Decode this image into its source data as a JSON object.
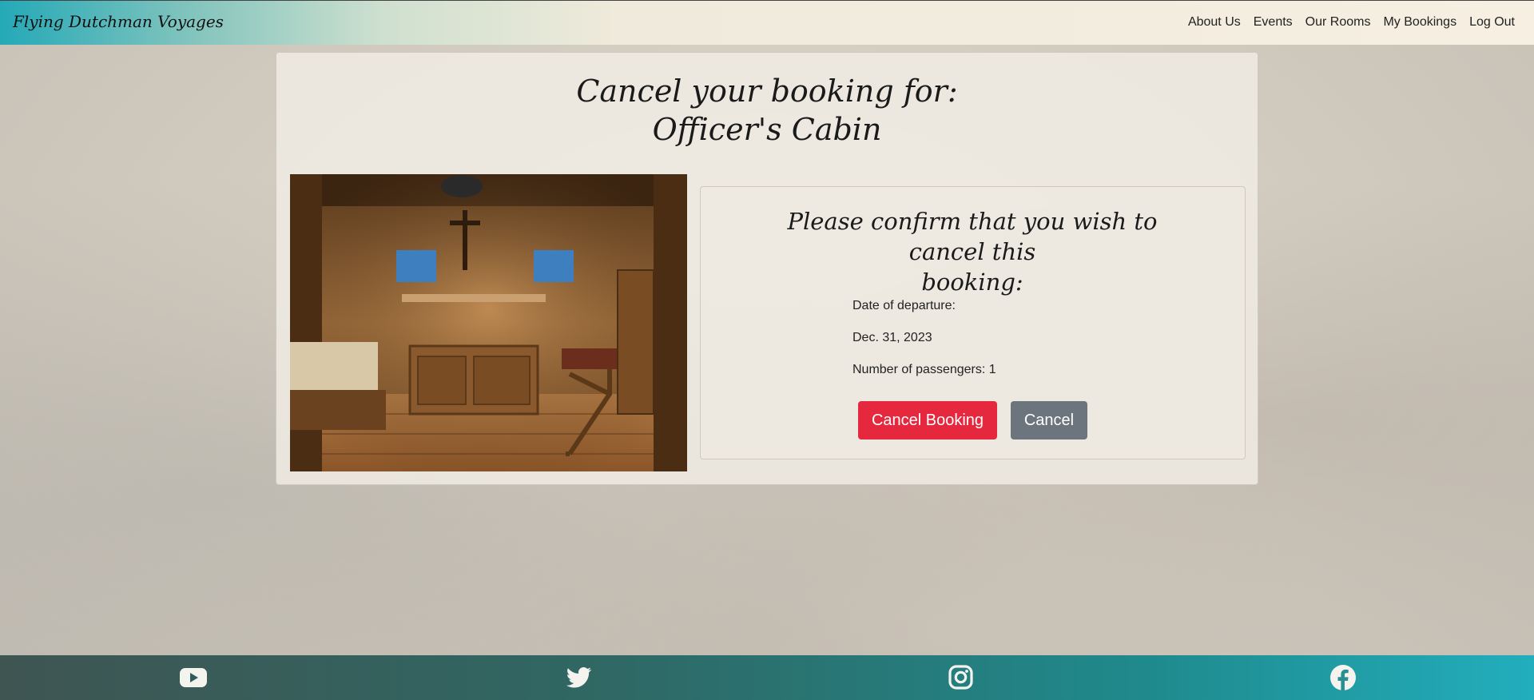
{
  "navbar": {
    "brand": "Flying Dutchman Voyages",
    "links": [
      {
        "label": "About Us"
      },
      {
        "label": "Events"
      },
      {
        "label": "Our Rooms"
      },
      {
        "label": "My Bookings"
      },
      {
        "label": "Log Out"
      }
    ]
  },
  "page": {
    "title_line1": "Cancel your booking for:",
    "title_line2": "Officer's Cabin"
  },
  "confirm": {
    "heading_line1": "Please confirm that you wish to cancel this",
    "heading_line2": "booking:",
    "departure_label": "Date of departure:",
    "departure_date": "Dec. 31, 2023",
    "passengers_text": "Number of passengers: 1",
    "cancel_booking_label": "Cancel Booking",
    "cancel_label": "Cancel"
  },
  "colors": {
    "danger": "#e6283e",
    "secondary": "#6c757d",
    "footer_start": "#3f5552",
    "footer_end": "#22aebd"
  },
  "footer": {
    "icons": [
      "youtube-icon",
      "twitter-icon",
      "instagram-icon",
      "facebook-icon"
    ]
  }
}
